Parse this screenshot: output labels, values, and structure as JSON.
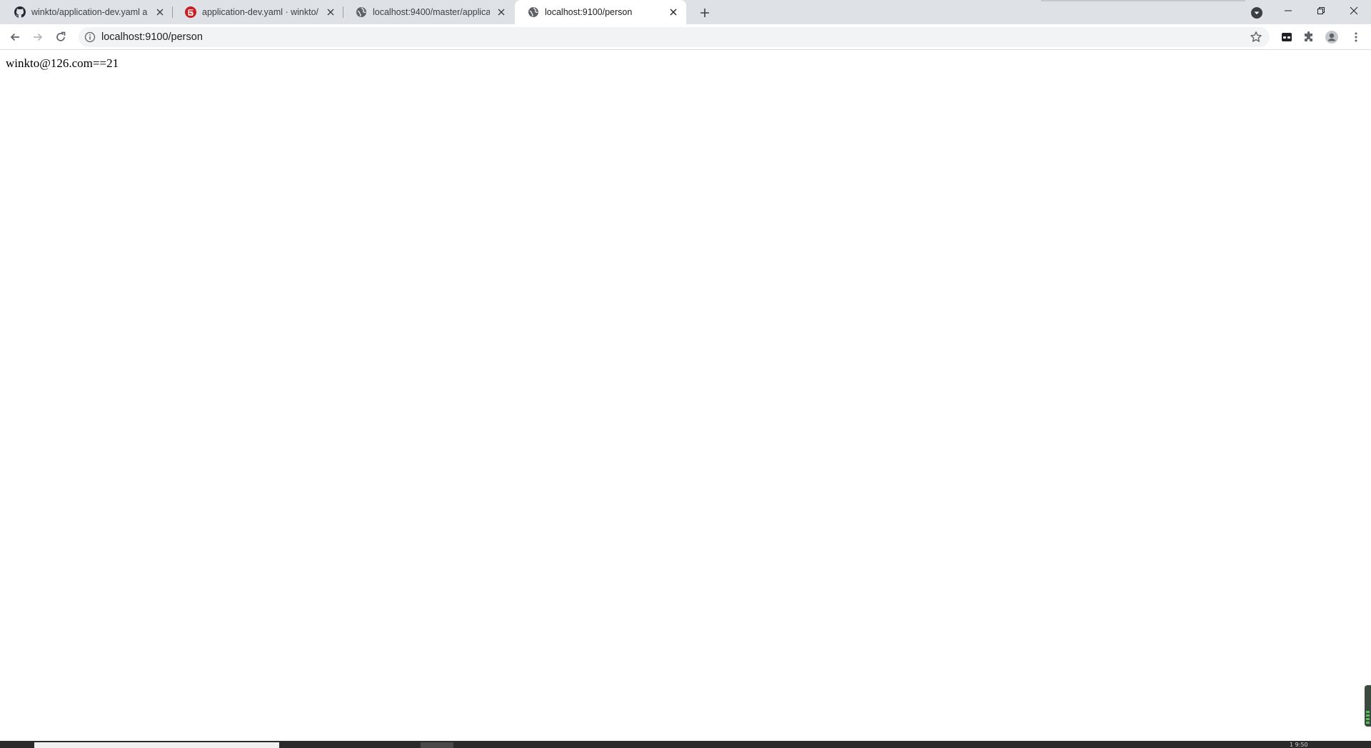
{
  "tabs": [
    {
      "title": "winkto/application-dev.yaml a",
      "favicon": "github-icon"
    },
    {
      "title": "application-dev.yaml · winkto/",
      "favicon": "gitee-icon"
    },
    {
      "title": "localhost:9400/master/applica",
      "favicon": "globe-icon"
    },
    {
      "title": "localhost:9100/person",
      "favicon": "globe-icon",
      "active": true
    }
  ],
  "toolbar": {
    "url": "localhost:9100/person"
  },
  "page": {
    "text": "winkto@126.com==21"
  },
  "taskbar": {
    "clock": "1 9:50"
  },
  "colors": {
    "tabstrip_bg": "#dee1e6",
    "omnibox_bg": "#f1f3f4",
    "gitee_red": "#c71d23"
  }
}
